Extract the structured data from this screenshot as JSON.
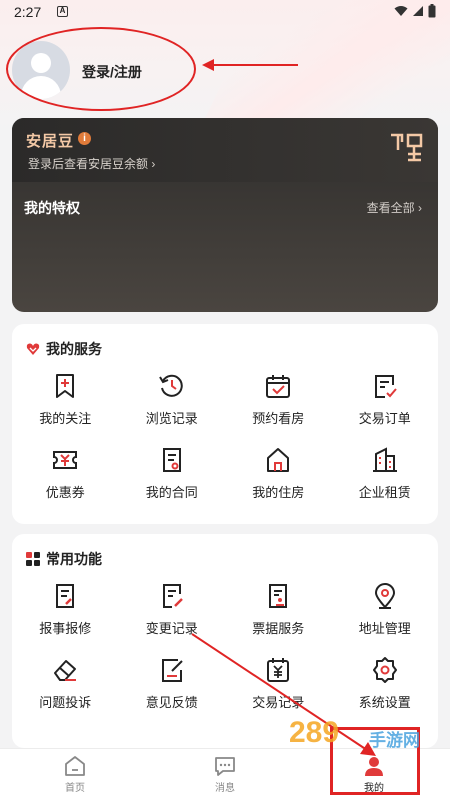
{
  "status": {
    "time": "2:27",
    "notif_glyph": "A"
  },
  "profile": {
    "login_label": "登录/注册"
  },
  "bean_card": {
    "title": "安居豆",
    "info_glyph": "i",
    "subtitle": "登录后查看安居豆余额 ›",
    "privileges_title": "我的特权",
    "view_all": "查看全部 ›"
  },
  "services": {
    "title": "我的服务",
    "items": [
      {
        "label": "我的关注",
        "icon": "bookmark-plus-icon"
      },
      {
        "label": "浏览记录",
        "icon": "history-icon"
      },
      {
        "label": "预约看房",
        "icon": "calendar-check-icon"
      },
      {
        "label": "交易订单",
        "icon": "order-check-icon"
      },
      {
        "label": "优惠券",
        "icon": "coupon-icon"
      },
      {
        "label": "我的合同",
        "icon": "contract-icon"
      },
      {
        "label": "我的住房",
        "icon": "house-icon"
      },
      {
        "label": "企业租赁",
        "icon": "building-icon"
      }
    ]
  },
  "functions": {
    "title": "常用功能",
    "items": [
      {
        "label": "报事报修",
        "icon": "repair-doc-icon"
      },
      {
        "label": "变更记录",
        "icon": "edit-doc-icon"
      },
      {
        "label": "票据服务",
        "icon": "receipt-icon"
      },
      {
        "label": "地址管理",
        "icon": "location-icon"
      },
      {
        "label": "问题投诉",
        "icon": "eraser-icon"
      },
      {
        "label": "意见反馈",
        "icon": "feedback-edit-icon"
      },
      {
        "label": "交易记录",
        "icon": "yen-calendar-icon"
      },
      {
        "label": "系统设置",
        "icon": "gear-icon"
      }
    ]
  },
  "nav": {
    "items": [
      {
        "label": "首页",
        "icon": "home-icon"
      },
      {
        "label": "消息",
        "icon": "message-icon"
      },
      {
        "label": "我的",
        "icon": "person-icon",
        "active": true
      }
    ]
  },
  "watermark": {
    "text": "手游网",
    "number": "289"
  },
  "colors": {
    "accent_red": "#e02424",
    "bean_gold": "#f4c9a6",
    "dark_card": "#3a3734"
  }
}
